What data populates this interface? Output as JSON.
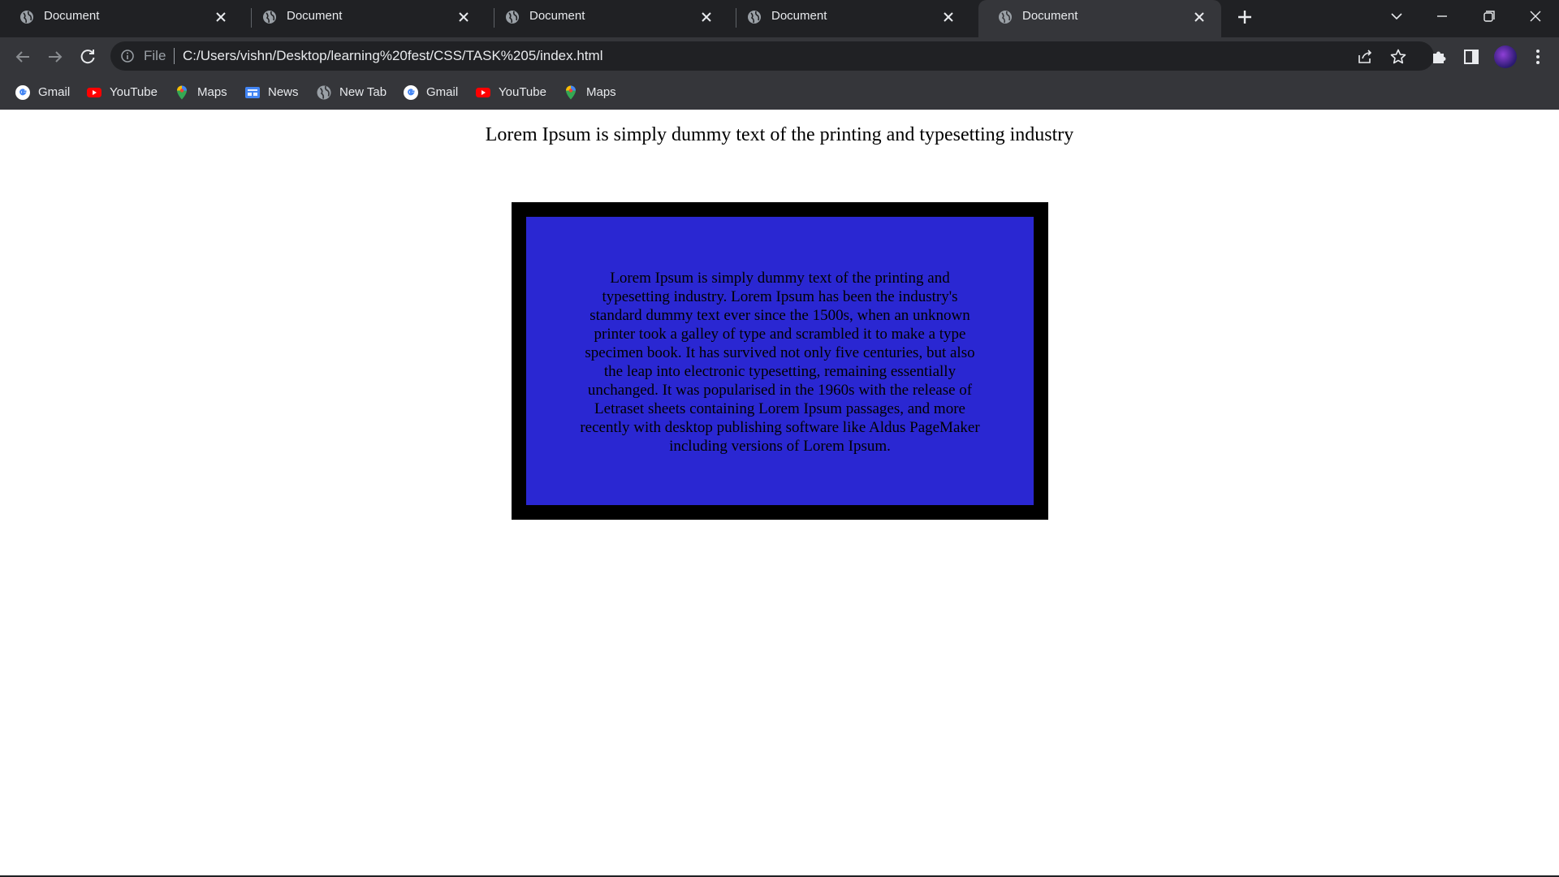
{
  "tabs": [
    {
      "title": "Document",
      "active": false
    },
    {
      "title": "Document",
      "active": false
    },
    {
      "title": "Document",
      "active": false
    },
    {
      "title": "Document",
      "active": false
    },
    {
      "title": "Document",
      "active": true
    }
  ],
  "address_bar": {
    "scheme_label": "File",
    "url": "C:/Users/vishn/Desktop/learning%20fest/CSS/TASK%205/index.html"
  },
  "bookmarks": [
    {
      "label": "Gmail",
      "icon": "google-icon"
    },
    {
      "label": "YouTube",
      "icon": "youtube-icon"
    },
    {
      "label": "Maps",
      "icon": "maps-icon"
    },
    {
      "label": "News",
      "icon": "news-icon"
    },
    {
      "label": "New Tab",
      "icon": "globe-icon"
    },
    {
      "label": "Gmail",
      "icon": "google-icon"
    },
    {
      "label": "YouTube",
      "icon": "youtube-icon"
    },
    {
      "label": "Maps",
      "icon": "maps-icon"
    }
  ],
  "page": {
    "heading": "Lorem Ipsum is simply dummy text of the printing and typesetting industry",
    "box_text": "Lorem Ipsum is simply dummy text of the printing and typesetting industry. Lorem Ipsum has been the industry's standard dummy text ever since the 1500s, when an unknown printer took a galley of type and scrambled it to make a type specimen book. It has survived not only five centuries, but also the leap into electronic typesetting, remaining essentially unchanged. It was popularised in the 1960s with the release of Letraset sheets containing Lorem Ipsum passages, and more recently with desktop publishing software like Aldus PageMaker including versions of Lorem Ipsum."
  },
  "colors": {
    "tabstrip": "#202124",
    "toolbar": "#35363a",
    "box_border": "#000000",
    "box_fill": "#2a27d2"
  }
}
